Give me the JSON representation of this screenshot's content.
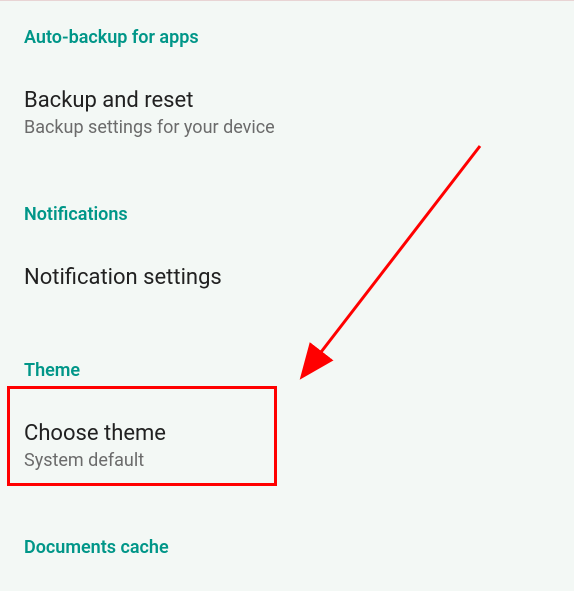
{
  "sections": {
    "autoBackup": {
      "header": "Auto-backup for apps"
    },
    "backupReset": {
      "title": "Backup and reset",
      "subtitle": "Backup settings for your device"
    },
    "notifications": {
      "header": "Notifications"
    },
    "notificationSettings": {
      "title": "Notification settings"
    },
    "theme": {
      "header": "Theme"
    },
    "chooseTheme": {
      "title": "Choose theme",
      "subtitle": "System default"
    },
    "documentsCache": {
      "header": "Documents cache"
    }
  },
  "annotation": {
    "highlightColor": "#ff0000",
    "arrowColor": "#ff0000"
  }
}
